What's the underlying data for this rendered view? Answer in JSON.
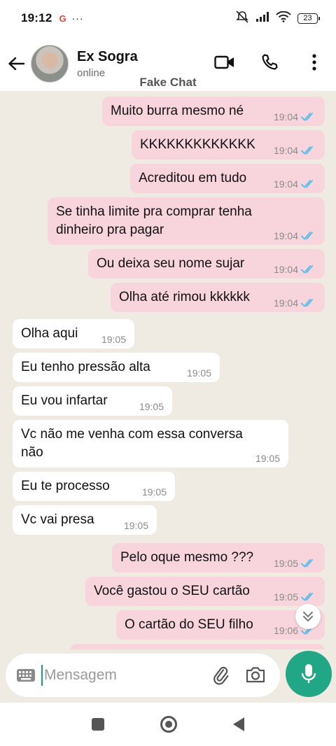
{
  "status_bar": {
    "time": "19:12",
    "google_glyph": "G",
    "more_glyph": "···",
    "battery": "23"
  },
  "header": {
    "contact_name": "Ex Sogra",
    "presence": "online"
  },
  "watermark": "Fake Chat",
  "messages": [
    {
      "dir": "out",
      "text": "Muito burra mesmo né",
      "time": "19:04"
    },
    {
      "dir": "out",
      "text": "KKKKKKKKKKKKK",
      "time": "19:04"
    },
    {
      "dir": "out",
      "text": "Acreditou em tudo",
      "time": "19:04"
    },
    {
      "dir": "out",
      "text": "Se tinha limite pra comprar tenha dinheiro pra pagar",
      "time": "19:04"
    },
    {
      "dir": "out",
      "text": "Ou deixa seu nome sujar",
      "time": "19:04"
    },
    {
      "dir": "out",
      "text": "Olha até rimou kkkkkk",
      "time": "19:04"
    },
    {
      "dir": "in",
      "text": "Olha aqui",
      "time": "19:05"
    },
    {
      "dir": "in",
      "text": "Eu tenho pressão alta",
      "time": "19:05"
    },
    {
      "dir": "in",
      "text": "Eu vou infartar",
      "time": "19:05"
    },
    {
      "dir": "in",
      "text": "Vc não me venha com essa conversa não",
      "time": "19:05"
    },
    {
      "dir": "in",
      "text": "Eu te processo",
      "time": "19:05"
    },
    {
      "dir": "in",
      "text": "Vc vai presa",
      "time": "19:05"
    },
    {
      "dir": "out",
      "text": "Pelo oque mesmo ???",
      "time": "19:05"
    },
    {
      "dir": "out",
      "text": "Você gastou o SEU cartão",
      "time": "19:05"
    },
    {
      "dir": "out",
      "text": "O cartão do SEU filho",
      "time": "19:06"
    }
  ],
  "composer": {
    "placeholder": "Mensagem"
  },
  "icons": [
    "back-arrow-icon",
    "video-call-icon",
    "phone-icon",
    "kebab-menu-icon",
    "double-check-icon",
    "keyboard-icon",
    "attach-icon",
    "camera-icon",
    "mic-icon",
    "chevron-double-down-icon"
  ],
  "colors": {
    "outgoing_bubble": "#f8d4dc",
    "incoming_bubble": "#ffffff",
    "chat_background": "#efeae2",
    "read_ticks": "#53bdeb",
    "mic_button": "#21a786"
  }
}
